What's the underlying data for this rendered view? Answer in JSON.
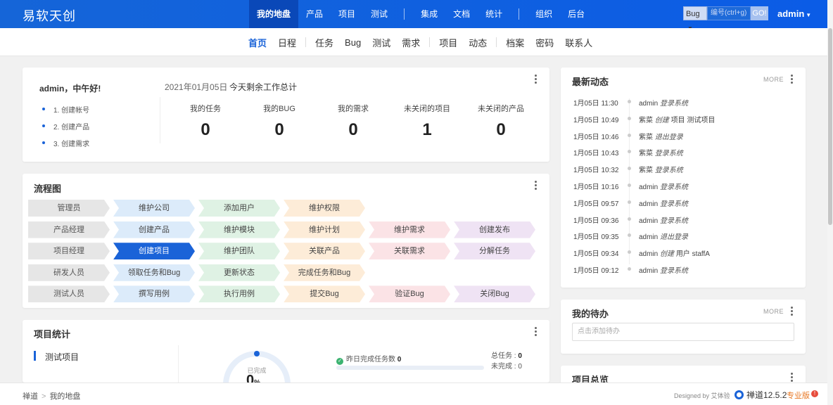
{
  "brand": "易软天创",
  "main_nav": [
    {
      "label": "我的地盘",
      "active": true
    },
    {
      "label": "产品"
    },
    {
      "label": "项目"
    },
    {
      "label": "测试"
    },
    {
      "sep": true
    },
    {
      "label": "集成"
    },
    {
      "label": "文档"
    },
    {
      "label": "统计"
    },
    {
      "sep": true
    },
    {
      "label": "组织"
    },
    {
      "label": "后台"
    }
  ],
  "search": {
    "type": "Bug",
    "placeholder": "编号(ctrl+g)",
    "go": "GO!"
  },
  "user": "admin",
  "sub_nav": [
    {
      "label": "首页",
      "active": true
    },
    {
      "label": "日程"
    },
    {
      "sep": true
    },
    {
      "label": "任务"
    },
    {
      "label": "Bug"
    },
    {
      "label": "测试"
    },
    {
      "label": "需求"
    },
    {
      "sep": true
    },
    {
      "label": "项目"
    },
    {
      "label": "动态"
    },
    {
      "sep": true
    },
    {
      "label": "档案"
    },
    {
      "label": "密码"
    },
    {
      "label": "联系人"
    }
  ],
  "welcome": {
    "greeting": "admin，中午好!",
    "steps": [
      "1. 创建帐号",
      "2. 创建产品",
      "3. 创建需求"
    ],
    "date": "2021年01月05日",
    "summary_title": "今天剩余工作总计",
    "stats": [
      {
        "label": "我的任务",
        "value": "0"
      },
      {
        "label": "我的BUG",
        "value": "0"
      },
      {
        "label": "我的需求",
        "value": "0"
      },
      {
        "label": "未关闭的项目",
        "value": "1"
      },
      {
        "label": "未关闭的产品",
        "value": "0"
      }
    ]
  },
  "flow": {
    "title": "流程图",
    "rows": [
      {
        "role": "管理员",
        "steps": [
          {
            "label": "维护公司",
            "color": "blue"
          },
          {
            "label": "添加用户",
            "color": "green"
          },
          {
            "label": "维护权限",
            "color": "orange"
          }
        ]
      },
      {
        "role": "产品经理",
        "steps": [
          {
            "label": "创建产品",
            "color": "blue"
          },
          {
            "label": "维护模块",
            "color": "green"
          },
          {
            "label": "维护计划",
            "color": "orange"
          },
          {
            "label": "维护需求",
            "color": "pink"
          },
          {
            "label": "创建发布",
            "color": "purple"
          }
        ]
      },
      {
        "role": "项目经理",
        "steps": [
          {
            "label": "创建项目",
            "color": "active"
          },
          {
            "label": "维护团队",
            "color": "green"
          },
          {
            "label": "关联产品",
            "color": "orange"
          },
          {
            "label": "关联需求",
            "color": "pink"
          },
          {
            "label": "分解任务",
            "color": "purple"
          }
        ]
      },
      {
        "role": "研发人员",
        "steps": [
          {
            "label": "领取任务和Bug",
            "color": "blue"
          },
          {
            "label": "更新状态",
            "color": "green"
          },
          {
            "label": "完成任务和Bug",
            "color": "orange"
          }
        ]
      },
      {
        "role": "测试人员",
        "steps": [
          {
            "label": "撰写用例",
            "color": "blue"
          },
          {
            "label": "执行用例",
            "color": "green"
          },
          {
            "label": "提交Bug",
            "color": "orange"
          },
          {
            "label": "验证Bug",
            "color": "pink"
          },
          {
            "label": "关闭Bug",
            "color": "purple"
          }
        ]
      }
    ]
  },
  "project_stats": {
    "title": "项目统计",
    "project": "测试项目",
    "done_label": "已完成",
    "percent": "0",
    "percent_unit": "%",
    "yesterday_label": "昨日完成任务数",
    "yesterday_value": "0",
    "total_label": "总任务 : ",
    "total_value": "0",
    "undone_label": "未完成 : ",
    "undone_value": "0"
  },
  "dynamics": {
    "title": "最新动态",
    "more": "MORE",
    "items": [
      {
        "time": "1月05日 11:30",
        "actor": "admin",
        "action": "登录系统",
        "object": ""
      },
      {
        "time": "1月05日 10:49",
        "actor": "紫菜",
        "action": "创建",
        "object": "项目 测试项目"
      },
      {
        "time": "1月05日 10:46",
        "actor": "紫菜",
        "action": "退出登录",
        "object": ""
      },
      {
        "time": "1月05日 10:43",
        "actor": "紫菜",
        "action": "登录系统",
        "object": ""
      },
      {
        "time": "1月05日 10:32",
        "actor": "紫菜",
        "action": "登录系统",
        "object": ""
      },
      {
        "time": "1月05日 10:16",
        "actor": "admin",
        "action": "登录系统",
        "object": ""
      },
      {
        "time": "1月05日 09:57",
        "actor": "admin",
        "action": "登录系统",
        "object": ""
      },
      {
        "time": "1月05日 09:36",
        "actor": "admin",
        "action": "登录系统",
        "object": ""
      },
      {
        "time": "1月05日 09:35",
        "actor": "admin",
        "action": "退出登录",
        "object": ""
      },
      {
        "time": "1月05日 09:34",
        "actor": "admin",
        "action": "创建",
        "object": "用户 staffA"
      },
      {
        "time": "1月05日 09:12",
        "actor": "admin",
        "action": "登录系统",
        "object": ""
      }
    ]
  },
  "todo": {
    "title": "我的待办",
    "more": "MORE",
    "placeholder": "点击添加待办"
  },
  "overview": {
    "title": "项目总览"
  },
  "footer": {
    "crumbs": [
      "禅道",
      "我的地盘"
    ],
    "designed": "Designed by 艾体验",
    "version": "禅道12.5.2",
    "edition": "专业版",
    "badge": "!"
  },
  "colors": {
    "primary": "#1a63d8",
    "header": "#0b5ce6"
  }
}
